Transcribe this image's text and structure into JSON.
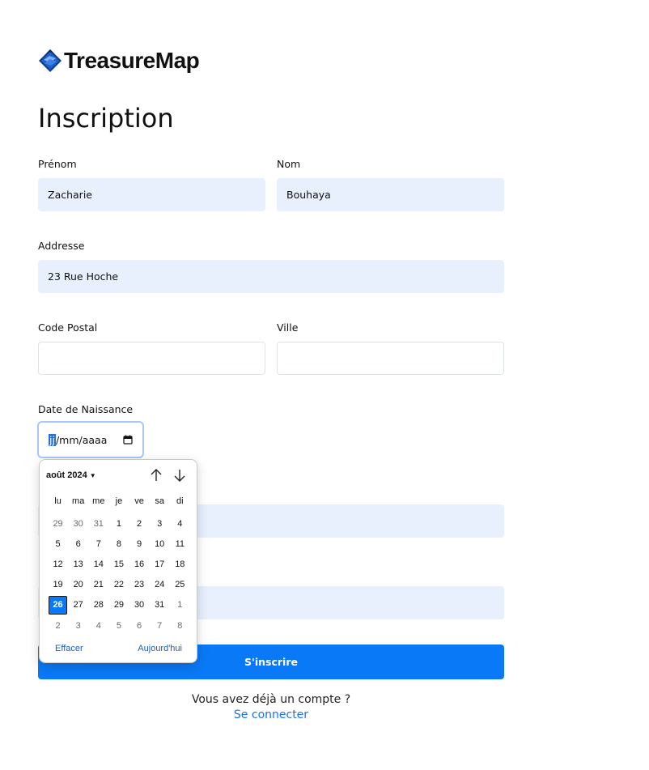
{
  "brand": {
    "name": "TreasureMap"
  },
  "page": {
    "title": "Inscription"
  },
  "form": {
    "prenom": {
      "label": "Prénom",
      "value": "Zacharie"
    },
    "nom": {
      "label": "Nom",
      "value": "Bouhaya"
    },
    "adresse": {
      "label": "Addresse",
      "value": "23 Rue Hoche"
    },
    "code_postal": {
      "label": "Code Postal",
      "value": ""
    },
    "ville": {
      "label": "Ville",
      "value": ""
    },
    "naissance": {
      "label": "Date de Naissance",
      "day_segment": "jj",
      "rest": "/mm/aaaa"
    },
    "submit_label": "S'inscrire"
  },
  "datepicker": {
    "month_label": "août 2024",
    "weekdays": [
      "lu",
      "ma",
      "me",
      "je",
      "ve",
      "sa",
      "di"
    ],
    "days": [
      {
        "d": "29",
        "other": true
      },
      {
        "d": "30",
        "other": true
      },
      {
        "d": "31",
        "other": true
      },
      {
        "d": "1"
      },
      {
        "d": "2"
      },
      {
        "d": "3"
      },
      {
        "d": "4"
      },
      {
        "d": "5"
      },
      {
        "d": "6"
      },
      {
        "d": "7"
      },
      {
        "d": "8"
      },
      {
        "d": "9"
      },
      {
        "d": "10"
      },
      {
        "d": "11"
      },
      {
        "d": "12"
      },
      {
        "d": "13"
      },
      {
        "d": "14"
      },
      {
        "d": "15"
      },
      {
        "d": "16"
      },
      {
        "d": "17"
      },
      {
        "d": "18"
      },
      {
        "d": "19"
      },
      {
        "d": "20"
      },
      {
        "d": "21"
      },
      {
        "d": "22"
      },
      {
        "d": "23"
      },
      {
        "d": "24"
      },
      {
        "d": "25"
      },
      {
        "d": "26",
        "selected": true
      },
      {
        "d": "27"
      },
      {
        "d": "28"
      },
      {
        "d": "29"
      },
      {
        "d": "30"
      },
      {
        "d": "31"
      },
      {
        "d": "1",
        "other": true
      },
      {
        "d": "2",
        "other": true
      },
      {
        "d": "3",
        "other": true
      },
      {
        "d": "4",
        "other": true
      },
      {
        "d": "5",
        "other": true
      },
      {
        "d": "6",
        "other": true
      },
      {
        "d": "7",
        "other": true
      },
      {
        "d": "8",
        "other": true
      }
    ],
    "clear_label": "Effacer",
    "today_label": "Aujourd'hui"
  },
  "footer": {
    "text": "Vous avez déjà un compte ?",
    "link": "Se connecter"
  }
}
